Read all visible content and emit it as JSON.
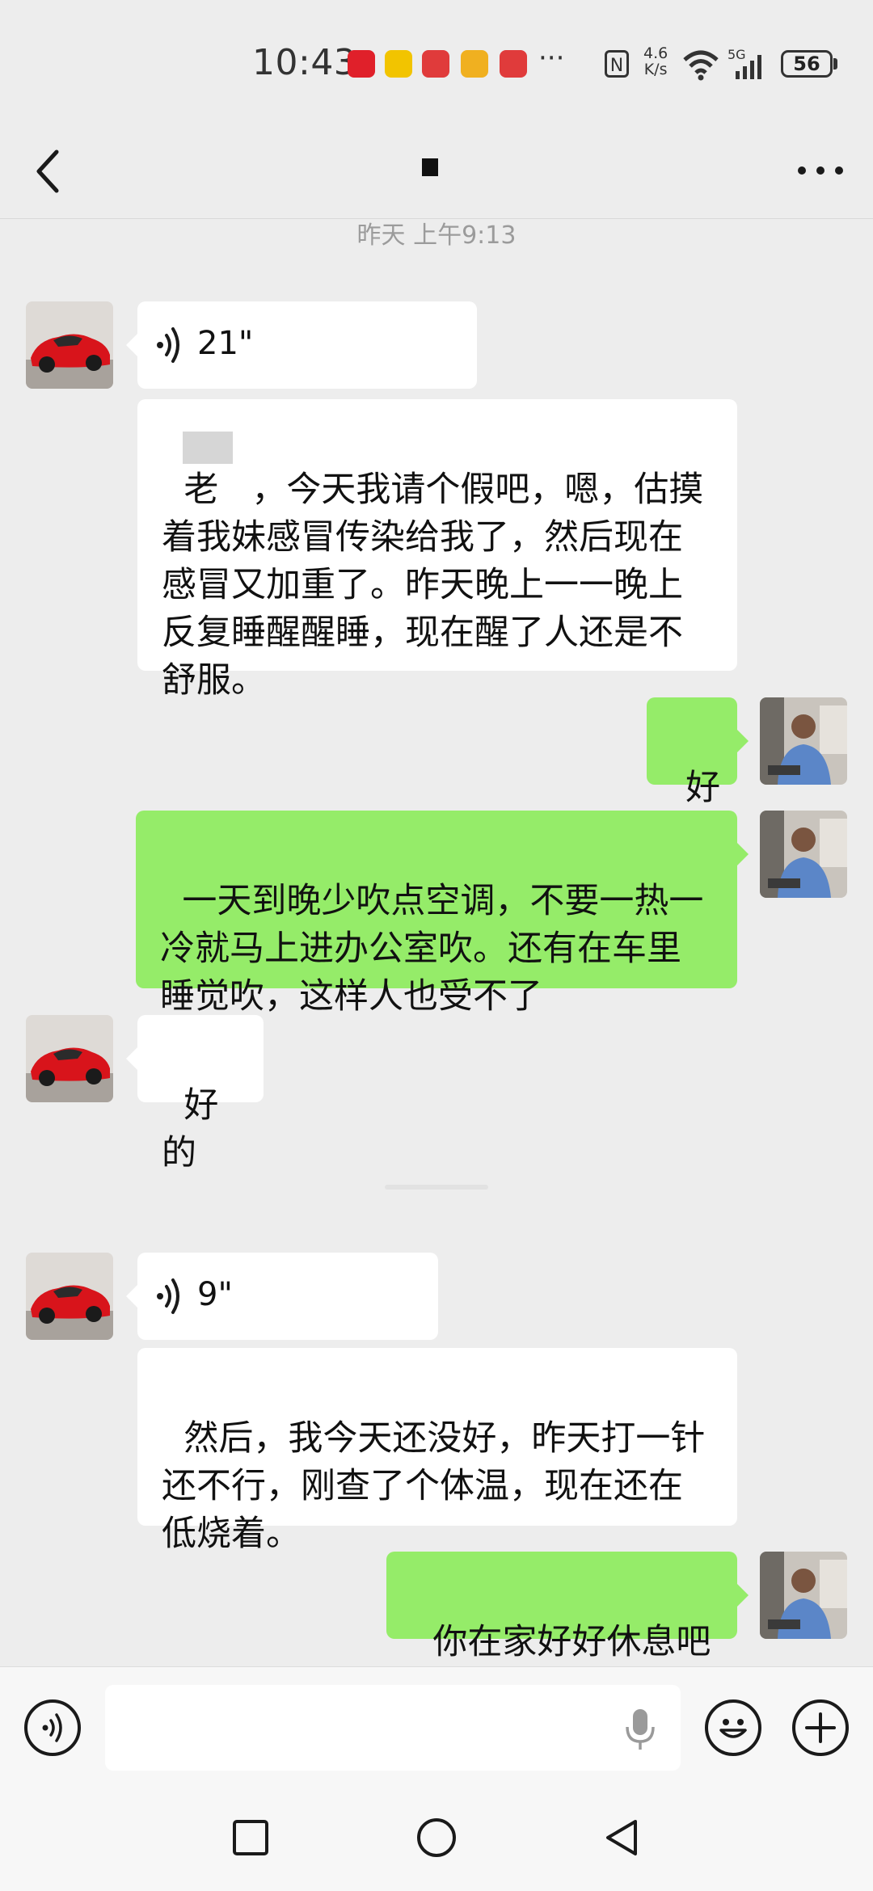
{
  "status_bar": {
    "time": "10:43",
    "more_indicator": "···",
    "nfc": "N",
    "net_speed_value": "4.6",
    "net_speed_unit": "K/s",
    "signal_label": "5G",
    "battery": "56",
    "icons": [
      "huawei-app-icon",
      "amap-icon",
      "notification-icon",
      "notification-icon",
      "notification-icon",
      "nfc-icon",
      "wifi-icon",
      "signal-icon",
      "battery-icon"
    ]
  },
  "header": {
    "title": "",
    "back_icon": "chevron-left-icon",
    "more_icon": "ellipsis-icon"
  },
  "chat": {
    "timestamp": "昨天 上午9:13",
    "messages": [
      {
        "side": "in",
        "type": "voice",
        "duration": "21\""
      },
      {
        "side": "in",
        "type": "text",
        "text": "老   ，今天我请个假吧，嗯，估摸着我妹感冒传染给我了，然后现在感冒又加重了。昨天晚上一一晚上反复睡醒醒睡，现在醒了人还是不舒服。"
      },
      {
        "side": "out",
        "type": "text",
        "text": "好"
      },
      {
        "side": "out",
        "type": "text",
        "text": "一天到晚少吹点空调，不要一热一冷就马上进办公室吹。还有在车里睡觉吹，这样人也受不了"
      },
      {
        "side": "in",
        "type": "text",
        "text": "好的"
      },
      {
        "side": "in",
        "type": "voice",
        "duration": "9\""
      },
      {
        "side": "in",
        "type": "text",
        "text": "然后，我今天还没好，昨天打一针还不行，刚查了个体温，现在还在低烧着。"
      },
      {
        "side": "out",
        "type": "text",
        "text": "你在家好好休息吧"
      }
    ]
  },
  "input_bar": {
    "value": "",
    "voice_toggle_icon": "voice-mode-icon",
    "mic_icon": "microphone-icon",
    "emoji_icon": "emoji-icon",
    "plus_icon": "plus-icon"
  },
  "nav_bar": {
    "icons": [
      "recents-square-icon",
      "home-circle-icon",
      "back-triangle-icon"
    ]
  },
  "colors": {
    "background": "#ededed",
    "incoming_bubble": "#ffffff",
    "outgoing_bubble": "#95ec69",
    "timestamp_text": "#9b9b9b"
  }
}
